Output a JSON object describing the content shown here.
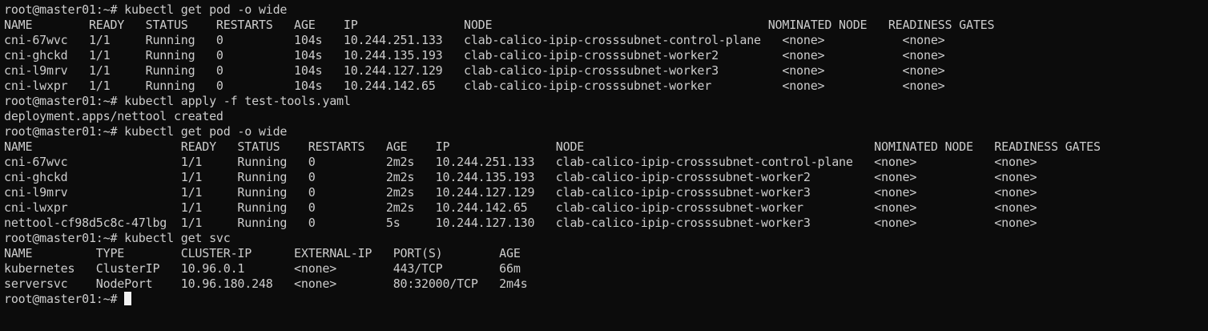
{
  "window": {
    "background": "#0c0c0c",
    "text_color": "#cccccc"
  },
  "lines": [
    "root@master01:~# kubectl get pod -o wide",
    "NAME        READY   STATUS    RESTARTS   AGE    IP               NODE                                       NOMINATED NODE   READINESS GATES",
    "cni-67wvc   1/1     Running   0          104s   10.244.251.133   clab-calico-ipip-crosssubnet-control-plane   <none>           <none>",
    "cni-ghckd   1/1     Running   0          104s   10.244.135.193   clab-calico-ipip-crosssubnet-worker2         <none>           <none>",
    "cni-l9mrv   1/1     Running   0          104s   10.244.127.129   clab-calico-ipip-crosssubnet-worker3         <none>           <none>",
    "cni-lwxpr   1/1     Running   0          104s   10.244.142.65    clab-calico-ipip-crosssubnet-worker          <none>           <none>",
    "root@master01:~# kubectl apply -f test-tools.yaml",
    "deployment.apps/nettool created",
    "root@master01:~# kubectl get pod -o wide",
    "NAME                     READY   STATUS    RESTARTS   AGE    IP               NODE                                         NOMINATED NODE   READINESS GATES",
    "cni-67wvc                1/1     Running   0          2m2s   10.244.251.133   clab-calico-ipip-crosssubnet-control-plane   <none>           <none>",
    "cni-ghckd                1/1     Running   0          2m2s   10.244.135.193   clab-calico-ipip-crosssubnet-worker2         <none>           <none>",
    "cni-l9mrv                1/1     Running   0          2m2s   10.244.127.129   clab-calico-ipip-crosssubnet-worker3         <none>           <none>",
    "cni-lwxpr                1/1     Running   0          2m2s   10.244.142.65    clab-calico-ipip-crosssubnet-worker          <none>           <none>",
    "nettool-cf98d5c8c-47lbg  1/1     Running   0          5s     10.244.127.130   clab-calico-ipip-crosssubnet-worker3         <none>           <none>",
    "root@master01:~# kubectl get svc",
    "NAME         TYPE        CLUSTER-IP      EXTERNAL-IP   PORT(S)        AGE",
    "kubernetes   ClusterIP   10.96.0.1       <none>        443/TCP        66m",
    "serversvc    NodePort    10.96.180.248   <none>        80:32000/TCP   2m4s"
  ],
  "prompt": {
    "text": "root@master01:~# "
  }
}
